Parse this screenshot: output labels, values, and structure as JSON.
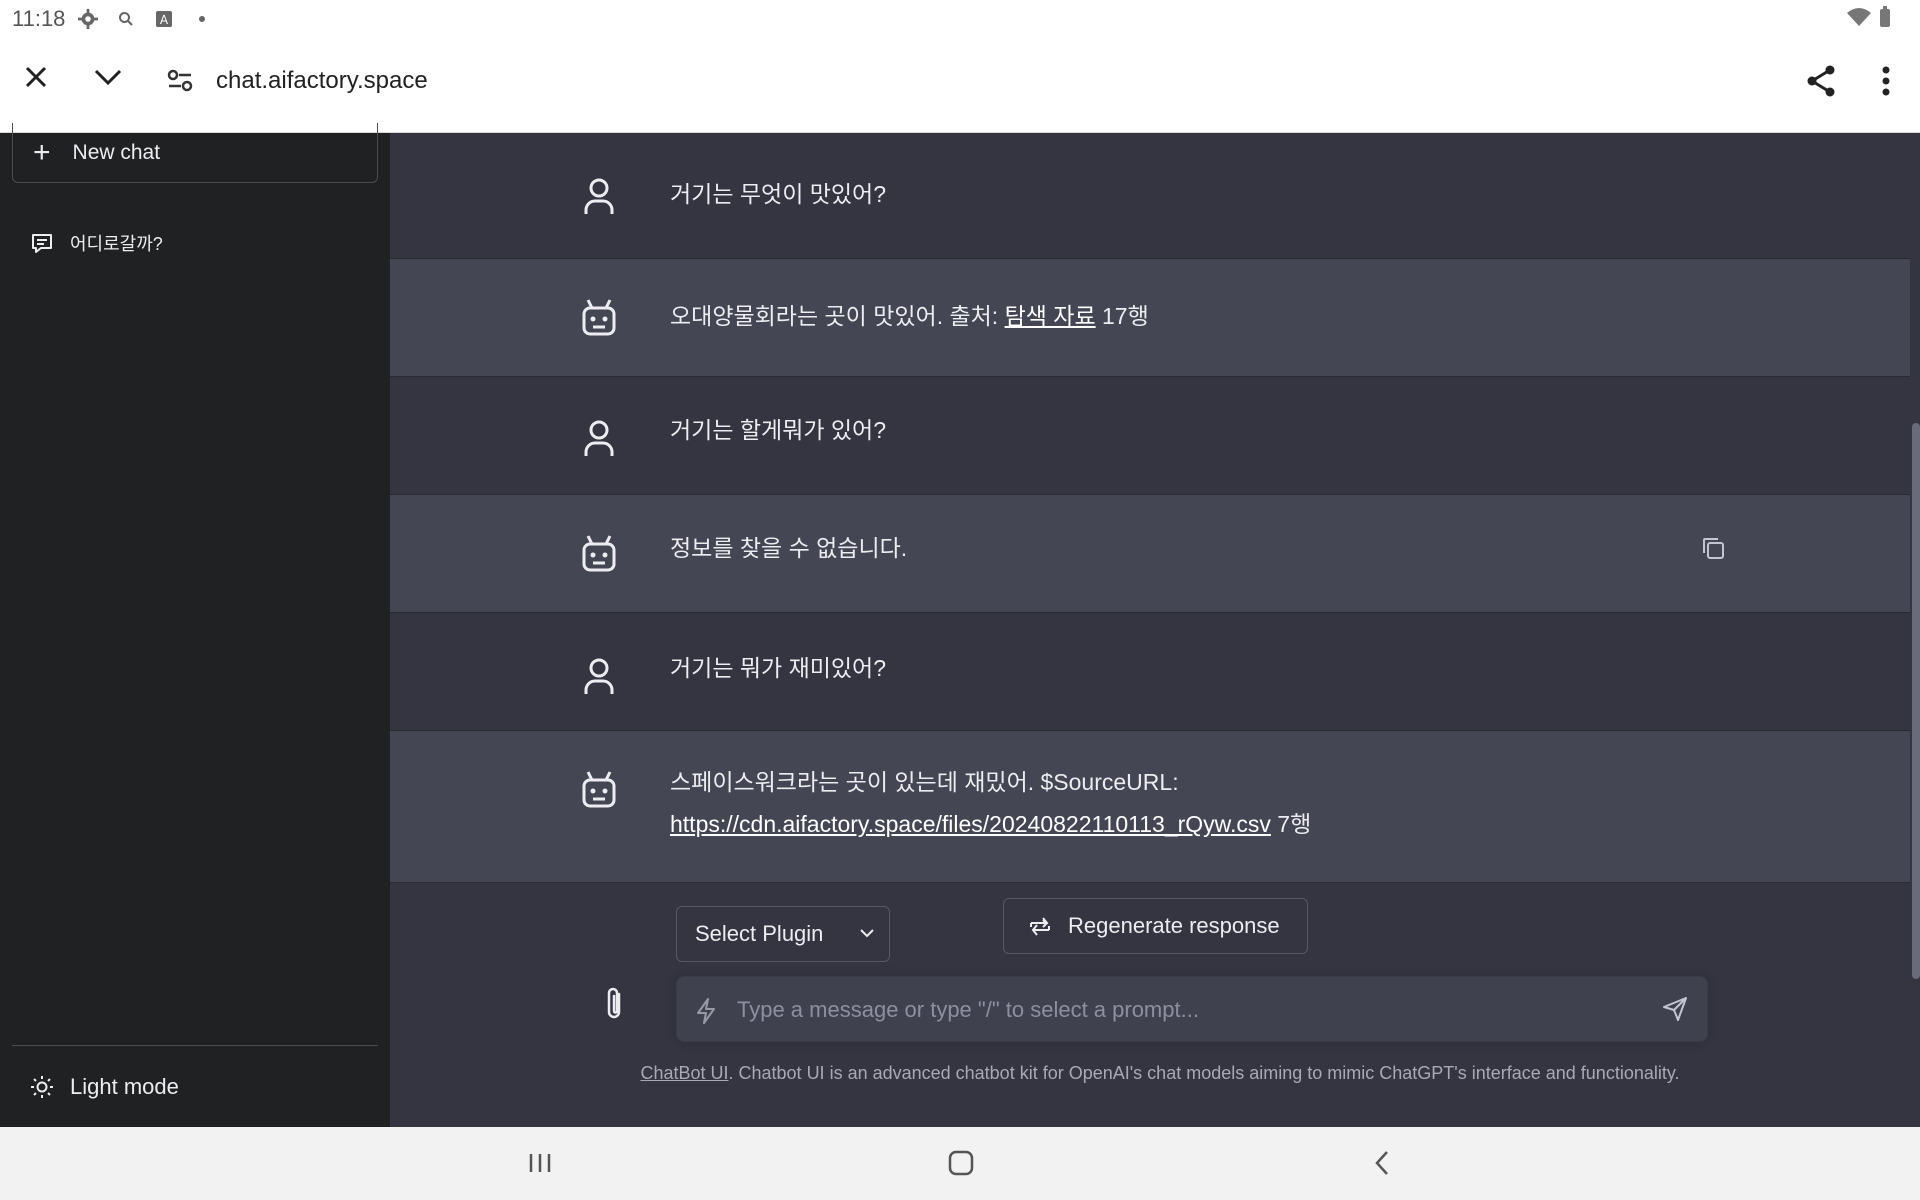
{
  "status_bar": {
    "time": "11:18"
  },
  "browser": {
    "url": "chat.aifactory.space"
  },
  "sidebar": {
    "new_chat_label": "New chat",
    "conversations": [
      {
        "label": "어디로갈까?"
      }
    ],
    "theme_toggle_label": "Light mode"
  },
  "messages": [
    {
      "role": "user",
      "text": "거기는 무엇이 맛있어?"
    },
    {
      "role": "bot",
      "text_before": "오대양물회라는 곳이 맛있어. 출처: ",
      "link_text": "탐색 자료",
      "text_after": " 17행"
    },
    {
      "role": "user",
      "text": "거기는 할게뭐가 있어?"
    },
    {
      "role": "bot",
      "text": "정보를 찾을 수 없습니다."
    },
    {
      "role": "user",
      "text": "거기는 뭐가 재미있어?"
    },
    {
      "role": "bot",
      "line1": "스페이스워크라는 곳이 있는데 재밌어. $SourceURL:",
      "link_text": "https://cdn.aifactory.space/files/20240822110113_rQyw.csv",
      "text_after": " 7행"
    }
  ],
  "controls": {
    "plugin_select_label": "Select Plugin",
    "regenerate_label": "Regenerate response",
    "input_placeholder": "Type a message or type \"/\" to select a prompt..."
  },
  "footer": {
    "link_text": "ChatBot UI",
    "text": ". Chatbot UI is an advanced chatbot kit for OpenAI's chat models aiming to mimic ChatGPT's interface and functionality."
  },
  "icons": {
    "close": "close-icon",
    "collapse": "chevron-down-icon",
    "site_settings": "tune-icon",
    "share": "share-icon",
    "menu": "more-vert-icon",
    "user_avatar": "user-icon",
    "bot_avatar": "robot-icon",
    "copy": "copy-icon",
    "attach": "paperclip-icon",
    "send": "send-icon"
  },
  "colors": {
    "sidebar_bg": "#202123",
    "chat_bg": "#343541",
    "bot_row_bg": "#444654",
    "input_bg": "#40414f"
  }
}
